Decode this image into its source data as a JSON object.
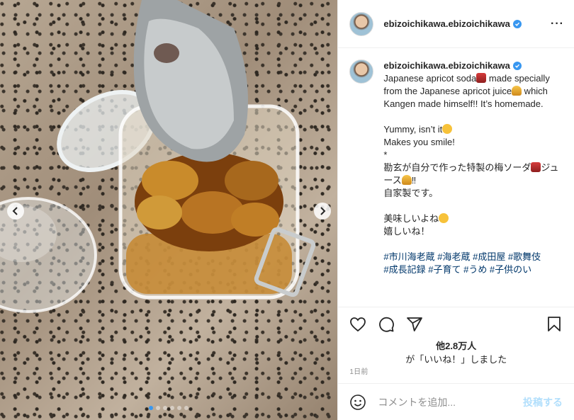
{
  "post": {
    "username": "ebizoichikawa.ebizoichikawa",
    "more_label": "···",
    "caption": {
      "line1": "Japanese apricot soda",
      "line2": " made specially from the Japanese apricot juice",
      "line3": " which Kangen made himself!! It’s homemade.",
      "line4": "Yummy, isn’t it",
      "line5": "Makes you smile!\n*\n勘玄が自分で作った特製の梅ソーダ",
      "line6": "ジュース",
      "line7": "‼︎\n自家製です。",
      "line8": "美味しいよね",
      "line9": "嬉しいね！",
      "hashtags": "#市川海老蔵 #海老蔵 #成田屋 #歌舞伎\n#成長記録 #子育て #うめ #子供のい"
    },
    "likes_count": "他2.8万人",
    "likes_text": "が「いいね！」しました",
    "timestamp": "1日前",
    "comment_placeholder": "コメントを追加...",
    "post_button": "投稿する"
  },
  "carousel": {
    "dots_total": 6,
    "active_index": 0
  },
  "colors": {
    "accent": "#3897f0",
    "link": "#00376b",
    "muted": "#8e8e8e",
    "post_disabled": "#b2dffc"
  }
}
